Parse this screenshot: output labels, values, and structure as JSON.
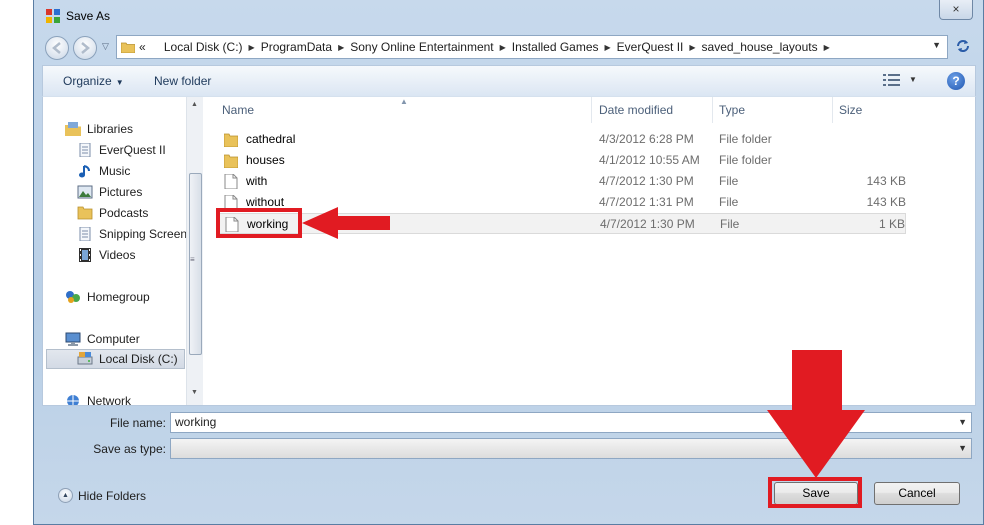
{
  "window": {
    "title": "Save As",
    "close_glyph": "×"
  },
  "address": {
    "chevrons": "«",
    "crumbs": [
      "Local Disk (C:)",
      "ProgramData",
      "Sony Online Entertainment",
      "Installed Games",
      "EverQuest II",
      "saved_house_layouts"
    ],
    "refresh_icon": "refresh-icon"
  },
  "toolbar": {
    "organize_label": "Organize",
    "new_folder_label": "New folder",
    "help_glyph": "?"
  },
  "nav": {
    "items": [
      {
        "label": "Libraries",
        "icon": "libraries-icon",
        "level": 0
      },
      {
        "label": "EverQuest II",
        "icon": "document-library-icon",
        "level": 1
      },
      {
        "label": "Music",
        "icon": "music-icon",
        "level": 1
      },
      {
        "label": "Pictures",
        "icon": "pictures-icon",
        "level": 1
      },
      {
        "label": "Podcasts",
        "icon": "folder-icon",
        "level": 1
      },
      {
        "label": "Snipping Screens",
        "icon": "document-library-icon",
        "level": 1
      },
      {
        "label": "Videos",
        "icon": "videos-icon",
        "level": 1
      },
      {
        "label": "Homegroup",
        "icon": "homegroup-icon",
        "level": 0
      },
      {
        "label": "Computer",
        "icon": "computer-icon",
        "level": 0
      },
      {
        "label": "Local Disk (C:)",
        "icon": "drive-icon",
        "level": 1,
        "selected": true
      },
      {
        "label": "Network",
        "icon": "network-icon",
        "level": 0
      }
    ]
  },
  "columns": {
    "name": "Name",
    "date": "Date modified",
    "type": "Type",
    "size": "Size"
  },
  "files": [
    {
      "name": "cathedral",
      "date": "4/3/2012 6:28 PM",
      "type": "File folder",
      "size": "",
      "icon": "folder-icon"
    },
    {
      "name": "houses",
      "date": "4/1/2012 10:55 AM",
      "type": "File folder",
      "size": "",
      "icon": "folder-icon"
    },
    {
      "name": "with",
      "date": "4/7/2012 1:30 PM",
      "type": "File",
      "size": "143 KB",
      "icon": "file-icon"
    },
    {
      "name": "without",
      "date": "4/7/2012 1:31 PM",
      "type": "File",
      "size": "143 KB",
      "icon": "file-icon"
    },
    {
      "name": "working",
      "date": "4/7/2012 1:30 PM",
      "type": "File",
      "size": "1 KB",
      "icon": "file-icon",
      "selected": true
    }
  ],
  "form": {
    "file_name_label": "File name:",
    "file_name_value": "working",
    "save_as_type_label": "Save as type:",
    "save_as_type_value": ""
  },
  "footer": {
    "hide_folders_label": "Hide Folders",
    "save_label": "Save",
    "cancel_label": "Cancel"
  },
  "annotation": {
    "color": "#e11b22"
  }
}
